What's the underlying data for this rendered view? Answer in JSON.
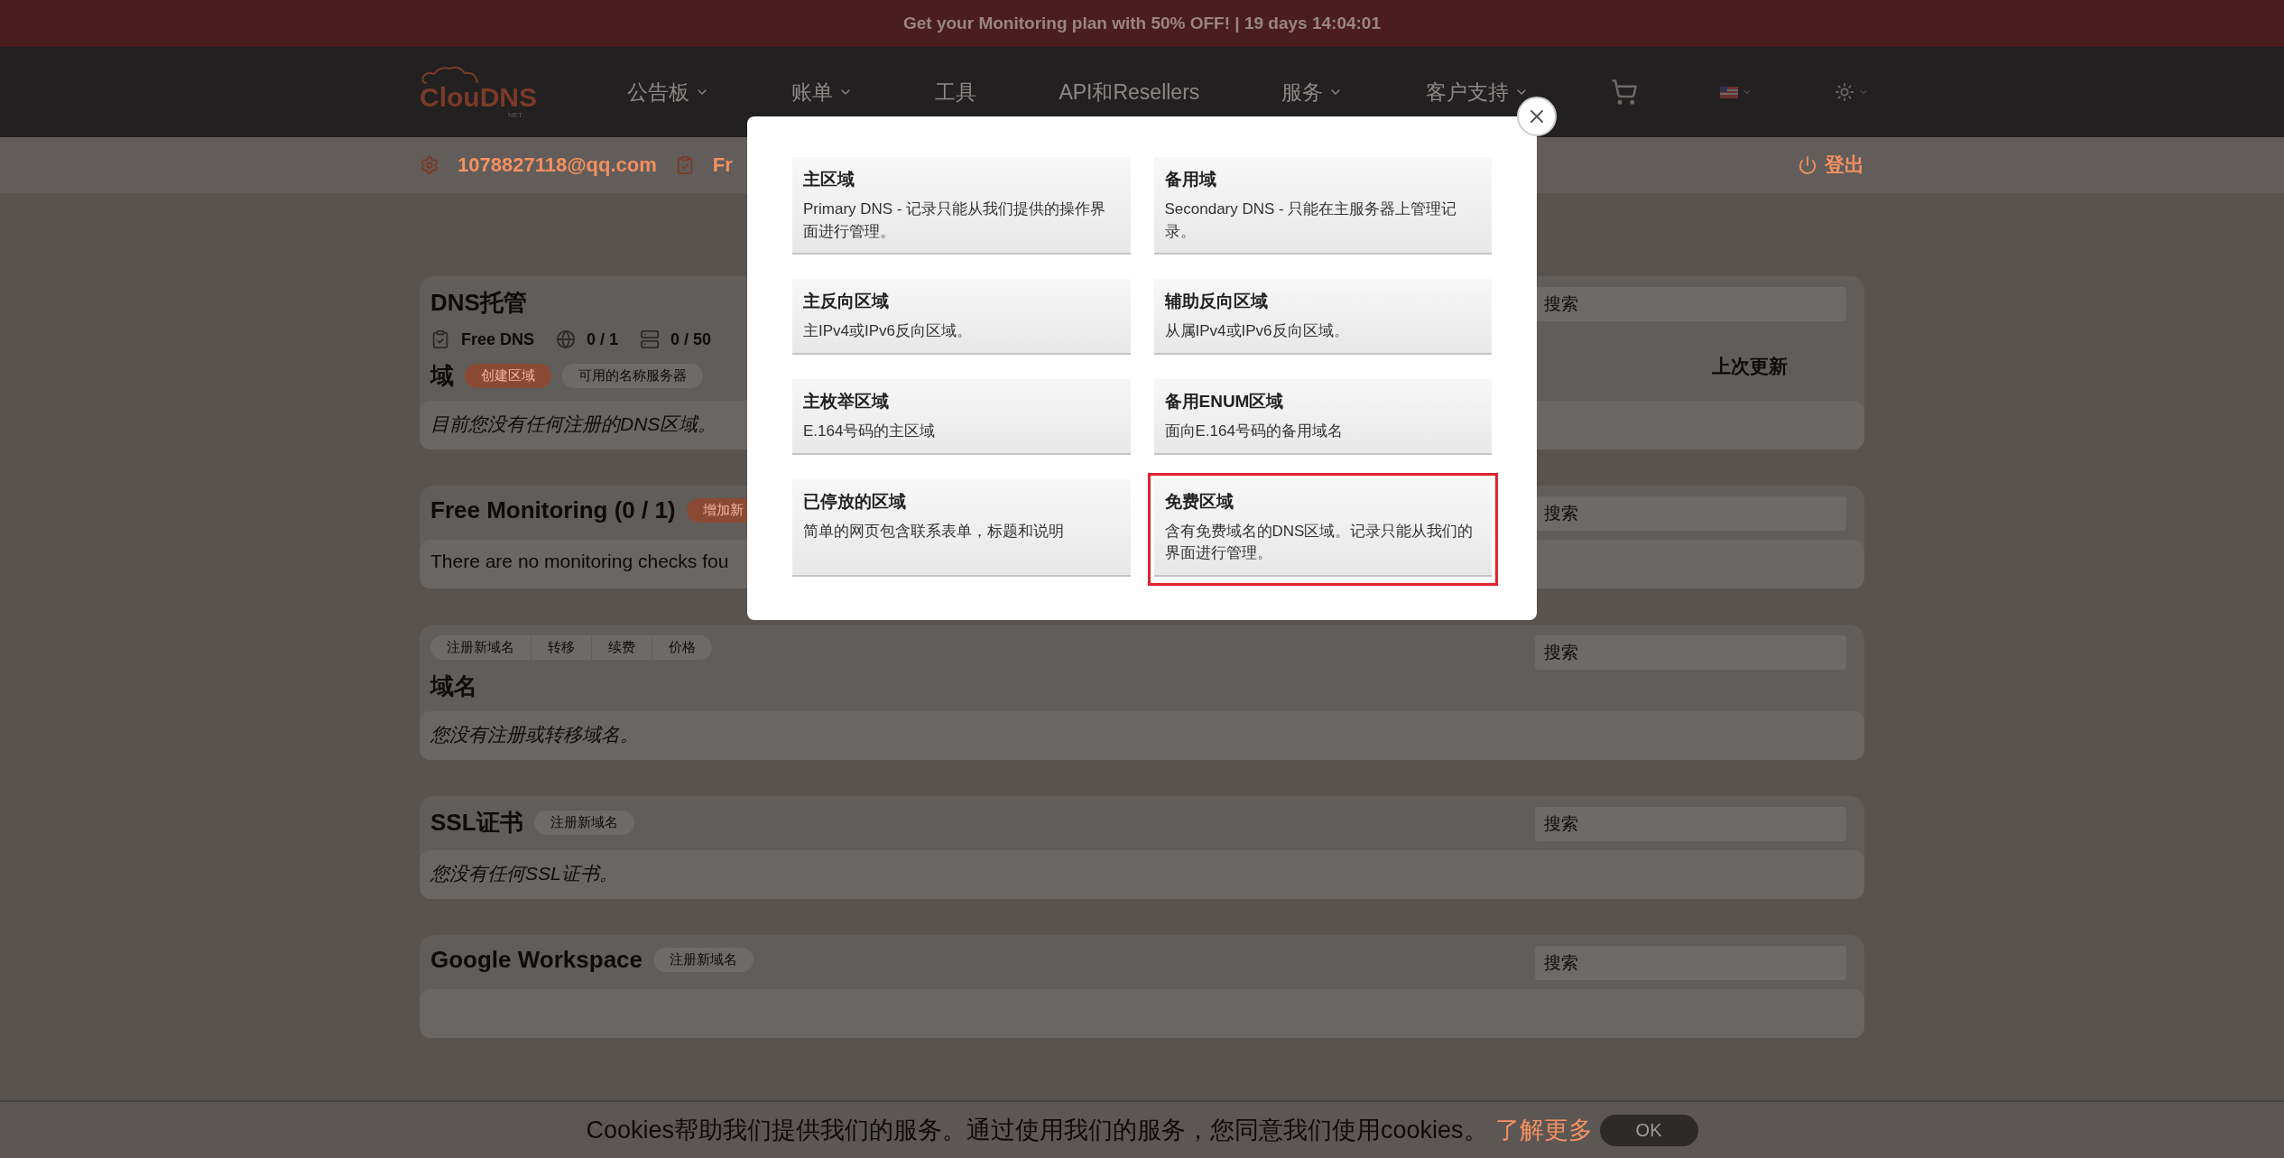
{
  "promo_banner": "Get your Monitoring plan with 50% OFF! | 19 days 14:04:01",
  "header": {
    "logo": "ClouDNS",
    "logo_sub": "NET",
    "nav": [
      {
        "label": "公告板",
        "dropdown": true
      },
      {
        "label": "账单",
        "dropdown": true
      },
      {
        "label": "工具",
        "dropdown": false
      },
      {
        "label": "API和Resellers",
        "dropdown": false
      },
      {
        "label": "服务",
        "dropdown": true
      },
      {
        "label": "客户支持",
        "dropdown": true
      }
    ]
  },
  "user_bar": {
    "email": "1078827118@qq.com",
    "plan": "Fr",
    "logout": "登出"
  },
  "sections": [
    {
      "title": "DNS托管",
      "stats": [
        {
          "kind": "plan",
          "text": "Free DNS"
        },
        {
          "kind": "zones",
          "text": "0 / 1"
        },
        {
          "kind": "records",
          "text": "0 / 50"
        }
      ],
      "subtitle": "域",
      "chips": [
        {
          "label": "创建区域",
          "kind": "primary"
        },
        {
          "label": "可用的名称服务器",
          "kind": "plain"
        }
      ],
      "search": {
        "placeholder": "搜索"
      },
      "column_header": "上次更新",
      "empty_message": "目前您没有任何注册的DNS区域。",
      "italic": true
    },
    {
      "title": "Free Monitoring (0 / 1)",
      "chips": [
        {
          "label": "增加新",
          "kind": "primary"
        }
      ],
      "search": {
        "placeholder": "搜索"
      },
      "empty_message": "There are no monitoring checks fou",
      "italic": false
    },
    {
      "tab_group": [
        "注册新域名",
        "转移",
        "续费",
        "价格"
      ],
      "title": "域名",
      "search": {
        "placeholder": "搜索"
      },
      "empty_message": "您没有注册或转移域名。",
      "italic": true
    },
    {
      "title": "SSL证书",
      "chips": [
        {
          "label": "注册新域名",
          "kind": "plain"
        }
      ],
      "search": {
        "placeholder": "搜索"
      },
      "empty_message": "您没有任何SSL证书。",
      "italic": true
    },
    {
      "title": "Google Workspace",
      "chips": [
        {
          "label": "注册新域名",
          "kind": "plain"
        }
      ],
      "search": {
        "placeholder": "搜索"
      }
    }
  ],
  "modal": {
    "options": [
      {
        "title": "主区域",
        "description": "Primary DNS - 记录只能从我们提供的操作界面进行管理。",
        "selected": false
      },
      {
        "title": "备用域",
        "description": "Secondary DNS - 只能在主服务器上管理记录。",
        "selected": false
      },
      {
        "title": "主反向区域",
        "description": "主IPv4或IPv6反向区域。",
        "selected": false
      },
      {
        "title": "辅助反向区域",
        "description": "从属IPv4或IPv6反向区域。",
        "selected": false
      },
      {
        "title": "主枚举区域",
        "description": "E.164号码的主区域",
        "selected": false
      },
      {
        "title": "备用ENUM区域",
        "description": "面向E.164号码的备用域名",
        "selected": false
      },
      {
        "title": "已停放的区域",
        "description": "简单的网页包含联系表单，标题和说明",
        "selected": false
      },
      {
        "title": "免费区域",
        "description": "含有免费域名的DNS区域。记录只能从我们的界面进行管理。",
        "selected": true
      }
    ]
  },
  "cookie_bar": {
    "text": "Cookies帮助我们提供我们的服务。通过使用我们的服务，您同意我们使用cookies。",
    "link": "了解更多",
    "button": "OK"
  }
}
